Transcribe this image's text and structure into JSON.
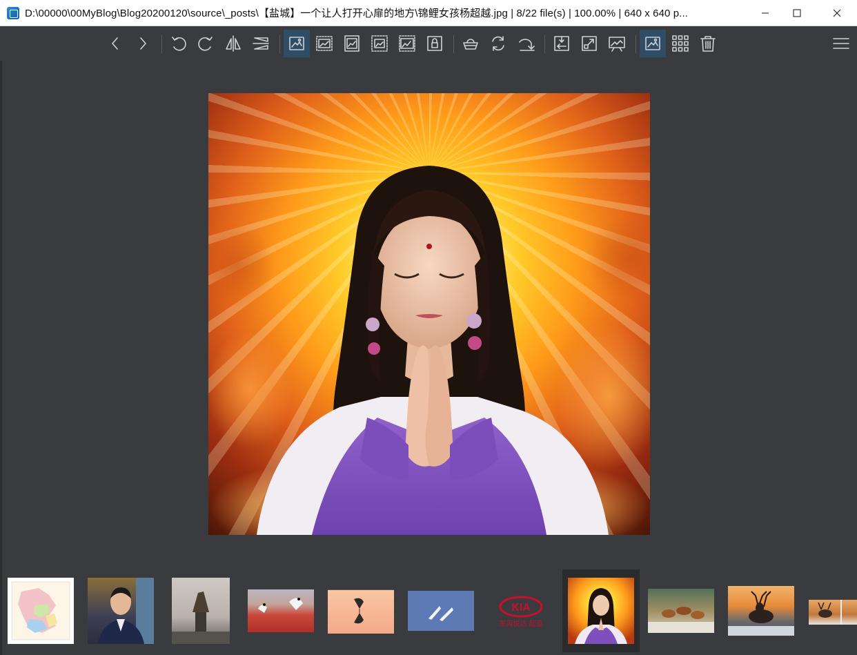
{
  "window": {
    "title": "D:\\00000\\00MyBlog\\Blog20200120\\source\\_posts\\【盐城】一个让人打开心扉的地方\\锦鲤女孩杨超越.jpg  |  8/22 file(s)  |  100.00%  |  640 x 640 p...",
    "controls": [
      "minimize-icon",
      "maximize-icon",
      "close-icon"
    ]
  },
  "toolbar": {
    "buttons": [
      {
        "name": "previous-button",
        "icon": "chevron-left-icon"
      },
      {
        "name": "next-button",
        "icon": "chevron-right-icon"
      },
      {
        "name": "rotate-left-button",
        "icon": "rotate-left-icon"
      },
      {
        "name": "rotate-right-button",
        "icon": "rotate-right-icon"
      },
      {
        "name": "flip-horizontal-button",
        "icon": "flip-horizontal-icon"
      },
      {
        "name": "flip-vertical-button",
        "icon": "flip-vertical-icon"
      },
      {
        "name": "auto-zoom-button",
        "icon": "image-fit-icon",
        "active": true
      },
      {
        "name": "scale-to-width-button",
        "icon": "image-width-icon"
      },
      {
        "name": "scale-to-height-button",
        "icon": "image-height-icon"
      },
      {
        "name": "scale-to-fit-button",
        "icon": "image-fit-dashed-icon"
      },
      {
        "name": "scale-to-fill-button",
        "icon": "image-fill-icon"
      },
      {
        "name": "lock-zoom-button",
        "icon": "lock-image-icon"
      },
      {
        "name": "checkerboard-button",
        "icon": "basket-icon"
      },
      {
        "name": "refresh-button",
        "icon": "refresh-icon"
      },
      {
        "name": "rotate-redo-button",
        "icon": "redo-arrow-icon"
      },
      {
        "name": "goto-image-button",
        "icon": "goto-image-icon"
      },
      {
        "name": "full-screen-button",
        "icon": "fullscreen-icon"
      },
      {
        "name": "slideshow-button",
        "icon": "slideshow-icon"
      },
      {
        "name": "view-image-button",
        "icon": "image-view-icon",
        "active": true
      },
      {
        "name": "thumbnail-grid-button",
        "icon": "grid-icon"
      },
      {
        "name": "delete-button",
        "icon": "trash-icon"
      }
    ],
    "menu": {
      "name": "main-menu-button",
      "icon": "hamburger-menu-icon"
    }
  },
  "viewer": {
    "image_name": "锦鲤女孩杨超越.jpg",
    "file_index": "8/22",
    "zoom": "100.00%",
    "dimensions": "640 x 640"
  },
  "thumbnails": [
    {
      "name": "thumb-map"
    },
    {
      "name": "thumb-man-portrait"
    },
    {
      "name": "thumb-statue"
    },
    {
      "name": "thumb-cranes-field"
    },
    {
      "name": "thumb-flamingo-reflection"
    },
    {
      "name": "thumb-cranes-sky"
    },
    {
      "name": "thumb-kia-logo",
      "text": "东风悦达·起亚",
      "logo": "KIA"
    },
    {
      "name": "thumb-praying-girl",
      "selected": true
    },
    {
      "name": "thumb-deer-herd"
    },
    {
      "name": "thumb-stag-sunset"
    },
    {
      "name": "thumb-deer-partial"
    }
  ],
  "colors": {
    "background": "#3a3b3e",
    "active_button": "#2f4d66",
    "icon": "#cfd2d6",
    "kia_red": "#c8102e"
  }
}
